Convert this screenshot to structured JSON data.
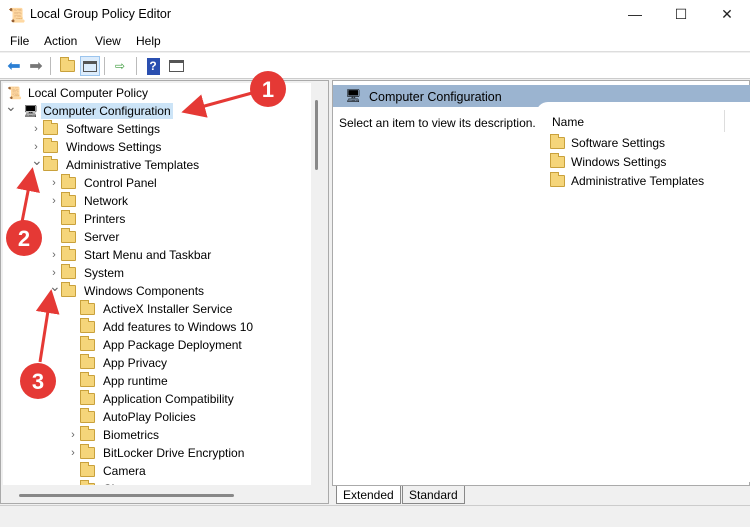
{
  "window": {
    "title": "Local Group Policy Editor",
    "minimize": "—",
    "maximize": "☐",
    "close": "✕"
  },
  "menu": [
    "File",
    "Action",
    "View",
    "Help"
  ],
  "toolbar": [
    "back-icon",
    "forward-icon",
    "up-folder-icon",
    "show-hide-console-tree-icon",
    "export-list-icon",
    "help-icon",
    "show-action-pane-icon"
  ],
  "tree": [
    {
      "label": "Local Computer Policy",
      "level": 0,
      "chev": "",
      "icon": "policy"
    },
    {
      "label": "Computer Configuration",
      "level": 0,
      "chev": "v",
      "icon": "computer",
      "selected": true
    },
    {
      "label": "Software Settings",
      "level": 1,
      "chev": ">"
    },
    {
      "label": "Windows Settings",
      "level": 1,
      "chev": ">"
    },
    {
      "label": "Administrative Templates",
      "level": 1,
      "chev": "v"
    },
    {
      "label": "Control Panel",
      "level": 2,
      "chev": ">"
    },
    {
      "label": "Network",
      "level": 2,
      "chev": ">"
    },
    {
      "label": "Printers",
      "level": 2,
      "chev": ""
    },
    {
      "label": "Server",
      "level": 2,
      "chev": ""
    },
    {
      "label": "Start Menu and Taskbar",
      "level": 2,
      "chev": ">"
    },
    {
      "label": "System",
      "level": 2,
      "chev": ">"
    },
    {
      "label": "Windows Components",
      "level": 2,
      "chev": "v"
    },
    {
      "label": "ActiveX Installer Service",
      "level": 3,
      "chev": ""
    },
    {
      "label": "Add features to Windows 10",
      "level": 3,
      "chev": ""
    },
    {
      "label": "App Package Deployment",
      "level": 3,
      "chev": ""
    },
    {
      "label": "App Privacy",
      "level": 3,
      "chev": ""
    },
    {
      "label": "App runtime",
      "level": 3,
      "chev": ""
    },
    {
      "label": "Application Compatibility",
      "level": 3,
      "chev": ""
    },
    {
      "label": "AutoPlay Policies",
      "level": 3,
      "chev": ""
    },
    {
      "label": "Biometrics",
      "level": 3,
      "chev": ">"
    },
    {
      "label": "BitLocker Drive Encryption",
      "level": 3,
      "chev": ">"
    },
    {
      "label": "Camera",
      "level": 3,
      "chev": ""
    },
    {
      "label": "Chat",
      "level": 3,
      "chev": ""
    }
  ],
  "right": {
    "title": "Computer Configuration",
    "description": "Select an item to view its description.",
    "column": "Name",
    "items": [
      "Software Settings",
      "Windows Settings",
      "Administrative Templates"
    ]
  },
  "tabs": [
    "Extended",
    "Standard"
  ],
  "annotations": [
    "1",
    "2",
    "3"
  ],
  "colors": {
    "header": "#9bb4d0",
    "selection": "#cce4f7",
    "annotation": "#e53935"
  }
}
